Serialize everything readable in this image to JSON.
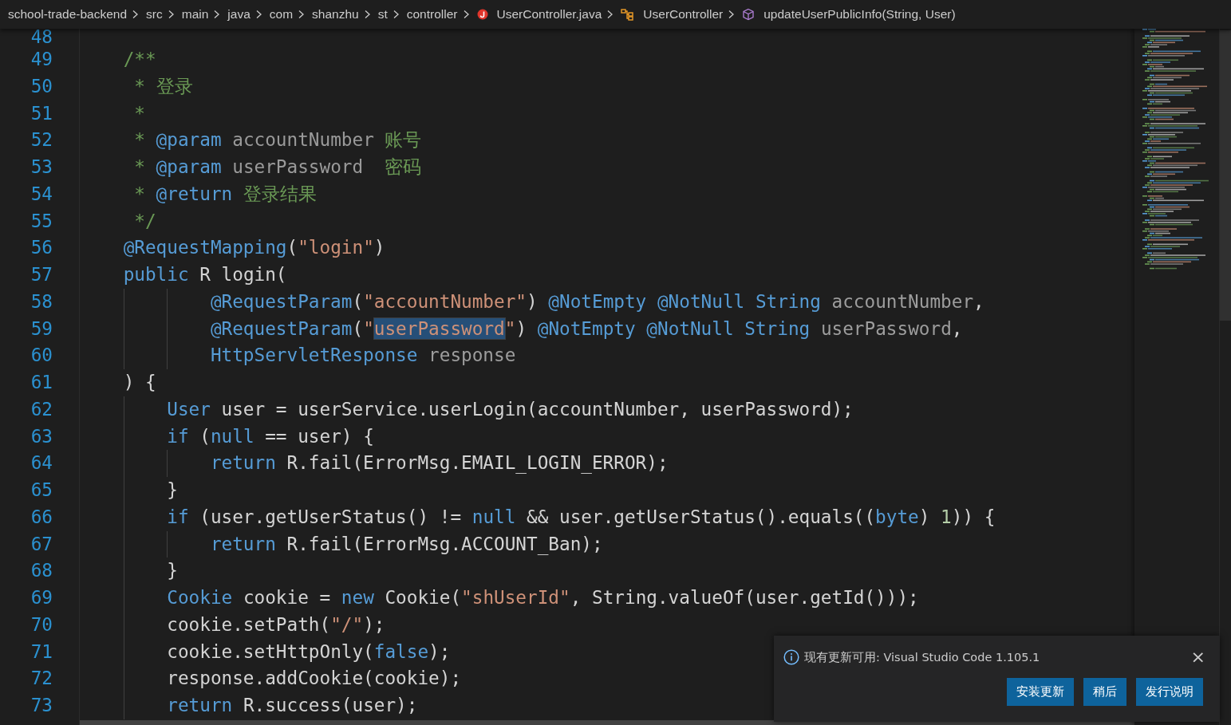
{
  "breadcrumb": [
    {
      "text": "school-trade-backend",
      "kind": "folder"
    },
    {
      "text": "src",
      "kind": "folder"
    },
    {
      "text": "main",
      "kind": "folder"
    },
    {
      "text": "java",
      "kind": "folder"
    },
    {
      "text": "com",
      "kind": "folder"
    },
    {
      "text": "shanzhu",
      "kind": "folder"
    },
    {
      "text": "st",
      "kind": "folder"
    },
    {
      "text": "controller",
      "kind": "folder"
    },
    {
      "text": "UserController.java",
      "kind": "file"
    },
    {
      "text": "UserController",
      "kind": "class"
    },
    {
      "text": "updateUserPublicInfo(String, User)",
      "kind": "method"
    }
  ],
  "editor": {
    "lines": [
      {
        "number": "48"
      },
      {
        "number": "49",
        "tokens": [
          {
            "kind": "comment",
            "text": "/**"
          }
        ]
      },
      {
        "number": "50",
        "tokens": [
          {
            "kind": "comment",
            "text": " * 登录"
          }
        ]
      },
      {
        "number": "51",
        "tokens": [
          {
            "kind": "comment",
            "text": " *"
          }
        ]
      },
      {
        "number": "52",
        "tokens": [
          {
            "kind": "comment",
            "text": " * "
          },
          {
            "kind": "doctag",
            "text": "@param"
          },
          {
            "kind": "docvar",
            "text": " accountNumber"
          },
          {
            "kind": "comment",
            "text": " 账号"
          }
        ]
      },
      {
        "number": "53",
        "tokens": [
          {
            "kind": "comment",
            "text": " * "
          },
          {
            "kind": "doctag",
            "text": "@param"
          },
          {
            "kind": "docvar",
            "text": " userPassword"
          },
          {
            "kind": "comment",
            "text": "  密码"
          }
        ]
      },
      {
        "number": "54",
        "tokens": [
          {
            "kind": "comment",
            "text": " * "
          },
          {
            "kind": "doctag",
            "text": "@return"
          },
          {
            "kind": "comment",
            "text": " 登录结果"
          }
        ]
      },
      {
        "number": "55",
        "tokens": [
          {
            "kind": "comment",
            "text": " */"
          }
        ]
      },
      {
        "number": "56",
        "tokens": [
          {
            "kind": "annotation",
            "text": "@RequestMapping"
          },
          {
            "kind": "plain",
            "text": "("
          },
          {
            "kind": "string",
            "text": "\"login\""
          },
          {
            "kind": "plain",
            "text": ")"
          }
        ]
      },
      {
        "number": "57",
        "tokens": [
          {
            "kind": "keyword",
            "text": "public"
          },
          {
            "kind": "plain",
            "text": " R login("
          }
        ],
        "children": [
          {
            "children": [
              {
                "number": "58",
                "tokens": [
                  {
                    "kind": "annotation",
                    "text": "@RequestParam"
                  },
                  {
                    "kind": "plain",
                    "text": "("
                  },
                  {
                    "kind": "string",
                    "text": "\"accountNumber\""
                  },
                  {
                    "kind": "plain",
                    "text": ") "
                  },
                  {
                    "kind": "annotation",
                    "text": "@NotEmpty"
                  },
                  {
                    "kind": "annotation",
                    "text": " @NotNull"
                  },
                  {
                    "kind": "type",
                    "text": " String"
                  },
                  {
                    "kind": "param",
                    "text": " accountNumber"
                  },
                  {
                    "kind": "plain",
                    "text": ","
                  }
                ]
              },
              {
                "number": "59",
                "tokens": [
                  {
                    "kind": "annotation",
                    "text": "@RequestParam"
                  },
                  {
                    "kind": "plain",
                    "text": "("
                  },
                  {
                    "kind": "string",
                    "text": "\""
                  },
                  {
                    "kind": "string-highlight",
                    "text": "userPassword"
                  },
                  {
                    "kind": "string",
                    "text": "\""
                  },
                  {
                    "kind": "plain",
                    "text": ") "
                  },
                  {
                    "kind": "annotation",
                    "text": "@NotEmpty"
                  },
                  {
                    "kind": "annotation",
                    "text": " @NotNull"
                  },
                  {
                    "kind": "type",
                    "text": " String"
                  },
                  {
                    "kind": "param",
                    "text": " userPassword"
                  },
                  {
                    "kind": "plain",
                    "text": ","
                  }
                ]
              },
              {
                "number": "60",
                "tokens": [
                  {
                    "kind": "type",
                    "text": "HttpServletResponse"
                  },
                  {
                    "kind": "param",
                    "text": " response"
                  }
                ]
              }
            ]
          }
        ]
      },
      {
        "number": "61",
        "tokens": [
          {
            "kind": "plain",
            "text": ") {"
          }
        ],
        "children": [
          {
            "number": "62",
            "tokens": [
              {
                "kind": "type",
                "text": "User"
              },
              {
                "kind": "plain",
                "text": " user = userService.userLogin(accountNumber, userPassword);"
              }
            ]
          },
          {
            "number": "63",
            "tokens": [
              {
                "kind": "keyword",
                "text": "if"
              },
              {
                "kind": "plain",
                "text": " ("
              },
              {
                "kind": "keyword",
                "text": "null"
              },
              {
                "kind": "plain",
                "text": " == user) {"
              }
            ],
            "children": [
              {
                "number": "64",
                "tokens": [
                  {
                    "kind": "keyword",
                    "text": "return"
                  },
                  {
                    "kind": "plain",
                    "text": " R.fail(ErrorMsg.EMAIL_LOGIN_ERROR);"
                  }
                ]
              }
            ]
          },
          {
            "number": "65",
            "tokens": [
              {
                "kind": "plain",
                "text": "}"
              }
            ]
          },
          {
            "number": "66",
            "tokens": [
              {
                "kind": "keyword",
                "text": "if"
              },
              {
                "kind": "plain",
                "text": " (user.getUserStatus() != "
              },
              {
                "kind": "keyword",
                "text": "null"
              },
              {
                "kind": "plain",
                "text": " && user.getUserStatus().equals(("
              },
              {
                "kind": "keyword",
                "text": "byte"
              },
              {
                "kind": "plain",
                "text": ") "
              },
              {
                "kind": "number",
                "text": "1"
              },
              {
                "kind": "plain",
                "text": ")) {"
              }
            ],
            "children": [
              {
                "number": "67",
                "tokens": [
                  {
                    "kind": "keyword",
                    "text": "return"
                  },
                  {
                    "kind": "plain",
                    "text": " R.fail(ErrorMsg.ACCOUNT_Ban);"
                  }
                ]
              }
            ]
          },
          {
            "number": "68",
            "tokens": [
              {
                "kind": "plain",
                "text": "}"
              }
            ]
          },
          {
            "number": "69",
            "tokens": [
              {
                "kind": "type",
                "text": "Cookie"
              },
              {
                "kind": "plain",
                "text": " cookie = "
              },
              {
                "kind": "keyword",
                "text": "new"
              },
              {
                "kind": "plain",
                "text": " Cookie("
              },
              {
                "kind": "string",
                "text": "\"shUserId\""
              },
              {
                "kind": "plain",
                "text": ", String.valueOf(user.getId()));"
              }
            ]
          },
          {
            "number": "70",
            "tokens": [
              {
                "kind": "plain",
                "text": "cookie.setPath("
              },
              {
                "kind": "string",
                "text": "\"/\""
              },
              {
                "kind": "plain",
                "text": ");"
              }
            ]
          },
          {
            "number": "71",
            "tokens": [
              {
                "kind": "plain",
                "text": "cookie.setHttpOnly("
              },
              {
                "kind": "keyword",
                "text": "false"
              },
              {
                "kind": "plain",
                "text": ");"
              }
            ]
          },
          {
            "number": "72",
            "tokens": [
              {
                "kind": "plain",
                "text": "response.addCookie(cookie);"
              }
            ]
          },
          {
            "number": "73",
            "tokens": [
              {
                "kind": "keyword",
                "text": "return"
              },
              {
                "kind": "plain",
                "text": " R.success(user);"
              }
            ]
          }
        ]
      }
    ]
  },
  "notification": {
    "message": "现有更新可用: Visual Studio Code 1.105.1",
    "close": "×",
    "buttons": [
      "安装更新",
      "稍后",
      "发行说明"
    ]
  }
}
